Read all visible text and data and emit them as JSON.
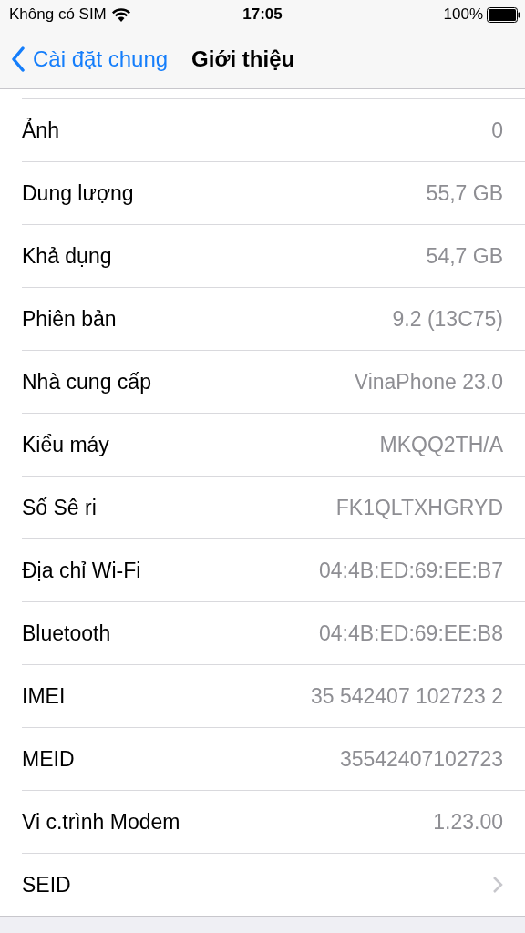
{
  "status_bar": {
    "carrier": "Không có SIM",
    "time": "17:05",
    "battery": "100%"
  },
  "nav_bar": {
    "back": "Cài đặt chung",
    "title": "Giới thiệu"
  },
  "rows": [
    {
      "kind": "value",
      "label": "Ảnh",
      "value": "0"
    },
    {
      "kind": "value",
      "label": "Dung lượng",
      "value": "55,7 GB"
    },
    {
      "kind": "value",
      "label": "Khả dụng",
      "value": "54,7 GB"
    },
    {
      "kind": "value",
      "label": "Phiên bản",
      "value": "9.2 (13C75)"
    },
    {
      "kind": "value",
      "label": "Nhà cung cấp",
      "value": "VinaPhone 23.0"
    },
    {
      "kind": "value",
      "label": "Kiểu máy",
      "value": "MKQQ2TH/A"
    },
    {
      "kind": "value",
      "label": "Số Sê ri",
      "value": "FK1QLTXHGRYD"
    },
    {
      "kind": "value",
      "label": "Địa chỉ Wi-Fi",
      "value": "04:4B:ED:69:EE:B7"
    },
    {
      "kind": "value",
      "label": "Bluetooth",
      "value": "04:4B:ED:69:EE:B8"
    },
    {
      "kind": "value",
      "label": "IMEI",
      "value": "35 542407 102723 2"
    },
    {
      "kind": "value",
      "label": "MEID",
      "value": "35542407102723"
    },
    {
      "kind": "value",
      "label": "Vi c.trình Modem",
      "value": "1.23.00"
    },
    {
      "kind": "link",
      "label": "SEID"
    }
  ]
}
